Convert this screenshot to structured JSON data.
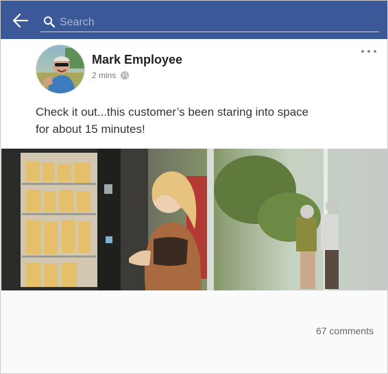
{
  "header": {
    "search_placeholder": "Search",
    "bar_color": "#3b5998"
  },
  "post": {
    "author": "Mark Employee",
    "time": "2 mins",
    "text": "Check it out...this customer’s been staring into space for about 15 minutes!",
    "comments": "67 comments",
    "icons": [
      "back-arrow-icon",
      "search-icon",
      "globe-icon",
      "more-icon"
    ]
  }
}
